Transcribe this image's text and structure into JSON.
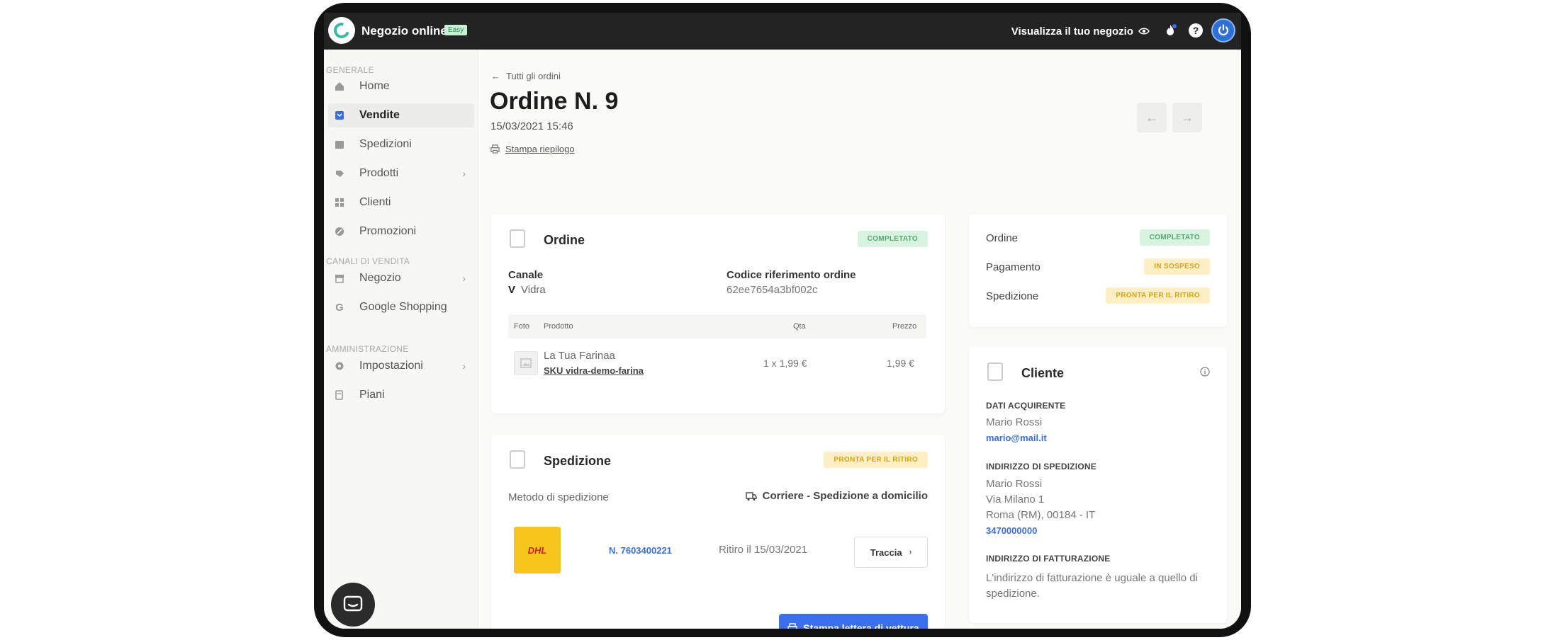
{
  "topbar": {
    "app_title": "Negozio online",
    "plan_badge": "Easy",
    "view_store": "Visualizza il tuo negozio",
    "help": "?"
  },
  "sidebar": {
    "sections": [
      {
        "label": "GENERALE"
      },
      {
        "label": "CANALI DI VENDITA"
      },
      {
        "label": "AMMINISTRAZIONE"
      }
    ],
    "items": [
      {
        "label": "Home",
        "icon": "home-icon"
      },
      {
        "label": "Vendite",
        "icon": "sales-icon",
        "active": true
      },
      {
        "label": "Spedizioni",
        "icon": "shipping-icon"
      },
      {
        "label": "Prodotti",
        "icon": "products-icon",
        "has_children": true
      },
      {
        "label": "Clienti",
        "icon": "customers-icon"
      },
      {
        "label": "Promozioni",
        "icon": "promotions-icon"
      },
      {
        "label": "Negozio",
        "icon": "store-icon",
        "has_children": true
      },
      {
        "label": "Google Shopping",
        "icon": "google-icon"
      },
      {
        "label": "Impostazioni",
        "icon": "settings-icon",
        "has_children": true
      },
      {
        "label": "Piani",
        "icon": "plans-icon"
      }
    ],
    "google_glyph": "G",
    "chevron": "›"
  },
  "header": {
    "back_link": "Tutti gli ordini",
    "title": "Ordine N. 9",
    "date": "15/03/2021 15:46",
    "print_summary": "Stampa riepilogo"
  },
  "order_card": {
    "title": "Ordine",
    "status": "COMPLETATO",
    "channel_label": "Canale",
    "channel_value": "Vidra",
    "channel_mark": "V",
    "ref_label": "Codice riferimento ordine",
    "ref_value": "62ee7654a3bf002c",
    "columns": {
      "photo": "Foto",
      "product": "Prodotto",
      "qty": "Qta",
      "price": "Prezzo"
    },
    "rows": [
      {
        "product": "La Tua Farinaa",
        "sku": "SKU vidra-demo-farina",
        "qty": "1 x 1,99 €",
        "price": "1,99 €"
      }
    ]
  },
  "shipping_card": {
    "title": "Spedizione",
    "status": "PRONTA PER IL RITIRO",
    "method_label": "Metodo di spedizione",
    "method_value": "Corriere - Spedizione a domicilio",
    "carrier_logo": "DHL",
    "tracking_number": "N. 7603400221",
    "pickup": "Ritiro il 15/03/2021",
    "track_button": "Traccia",
    "waybill_button": "Stampa lettera di vettura"
  },
  "summary_card": {
    "rows": [
      {
        "label": "Ordine",
        "status": "COMPLETATO",
        "color": "green"
      },
      {
        "label": "Pagamento",
        "status": "IN SOSPESO",
        "color": "yellow"
      },
      {
        "label": "Spedizione",
        "status": "PRONTA PER IL RITIRO",
        "color": "yellow"
      }
    ]
  },
  "customer_card": {
    "title": "Cliente",
    "buyer_heading": "DATI ACQUIRENTE",
    "buyer_name": "Mario Rossi",
    "buyer_email": "mario@mail.it",
    "shipping_heading": "INDIRIZZO DI SPEDIZIONE",
    "ship_name": "Mario Rossi",
    "ship_street": "Via Milano 1",
    "ship_city": "Roma (RM), 00184 - IT",
    "ship_phone": "3470000000",
    "billing_heading": "INDIRIZZO DI FATTURAZIONE",
    "billing_note": "L'indirizzo di fatturazione è uguale a quello di spedizione."
  },
  "colors": {
    "accent": "#3b6ff0",
    "topbar": "#232323",
    "status_green_bg": "#d8f3e0",
    "status_yellow_bg": "#fdefc4"
  }
}
